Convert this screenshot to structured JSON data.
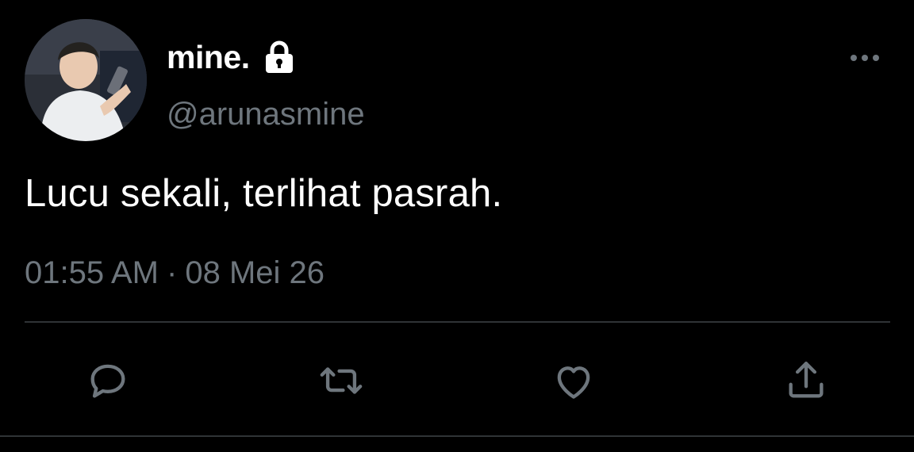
{
  "user": {
    "display_name": "mine.",
    "handle": "@arunasmine",
    "protected_icon": "lock-icon",
    "avatar": "avatar-photo"
  },
  "tweet": {
    "text": "Lucu sekali, terlihat pasrah.",
    "time": "01:55 AM",
    "separator": "·",
    "date": "08 Mei 26"
  },
  "actions": [
    {
      "icon": "reply-icon"
    },
    {
      "icon": "retweet-icon"
    },
    {
      "icon": "like-icon"
    },
    {
      "icon": "share-icon"
    }
  ],
  "menu": {
    "icon": "more-options-icon"
  },
  "colors": {
    "background": "#000000",
    "primary_text": "#ffffff",
    "secondary_text": "#6e767d",
    "divider": "#2f3336"
  }
}
